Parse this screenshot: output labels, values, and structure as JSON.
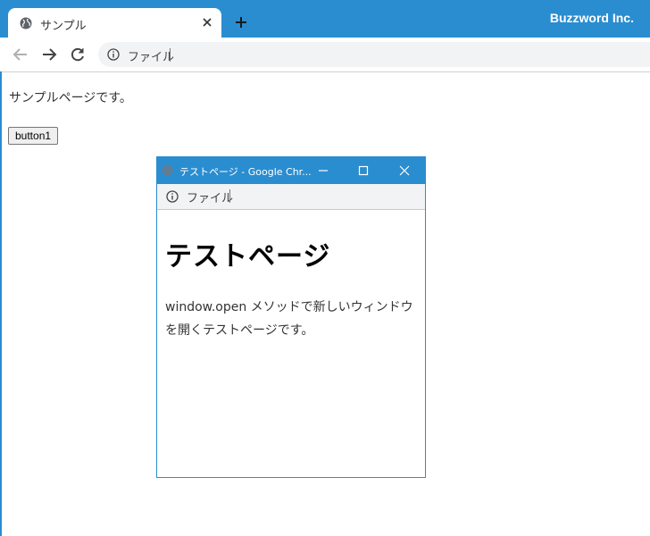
{
  "browser": {
    "tab_title": "サンプル",
    "brand": "Buzzword Inc.",
    "address_scheme": "ファイル"
  },
  "page": {
    "text": "サンプルページです。",
    "button_label": "button1"
  },
  "popup": {
    "window_title": "テストページ - Google Chr...",
    "address_scheme": "ファイル",
    "heading": "テストページ",
    "description": "window.open メソッドで新しいウィンドウを開くテストページです。"
  },
  "colors": {
    "accent": "#2a8dd0",
    "omnibox_bg": "#f1f3f4"
  }
}
